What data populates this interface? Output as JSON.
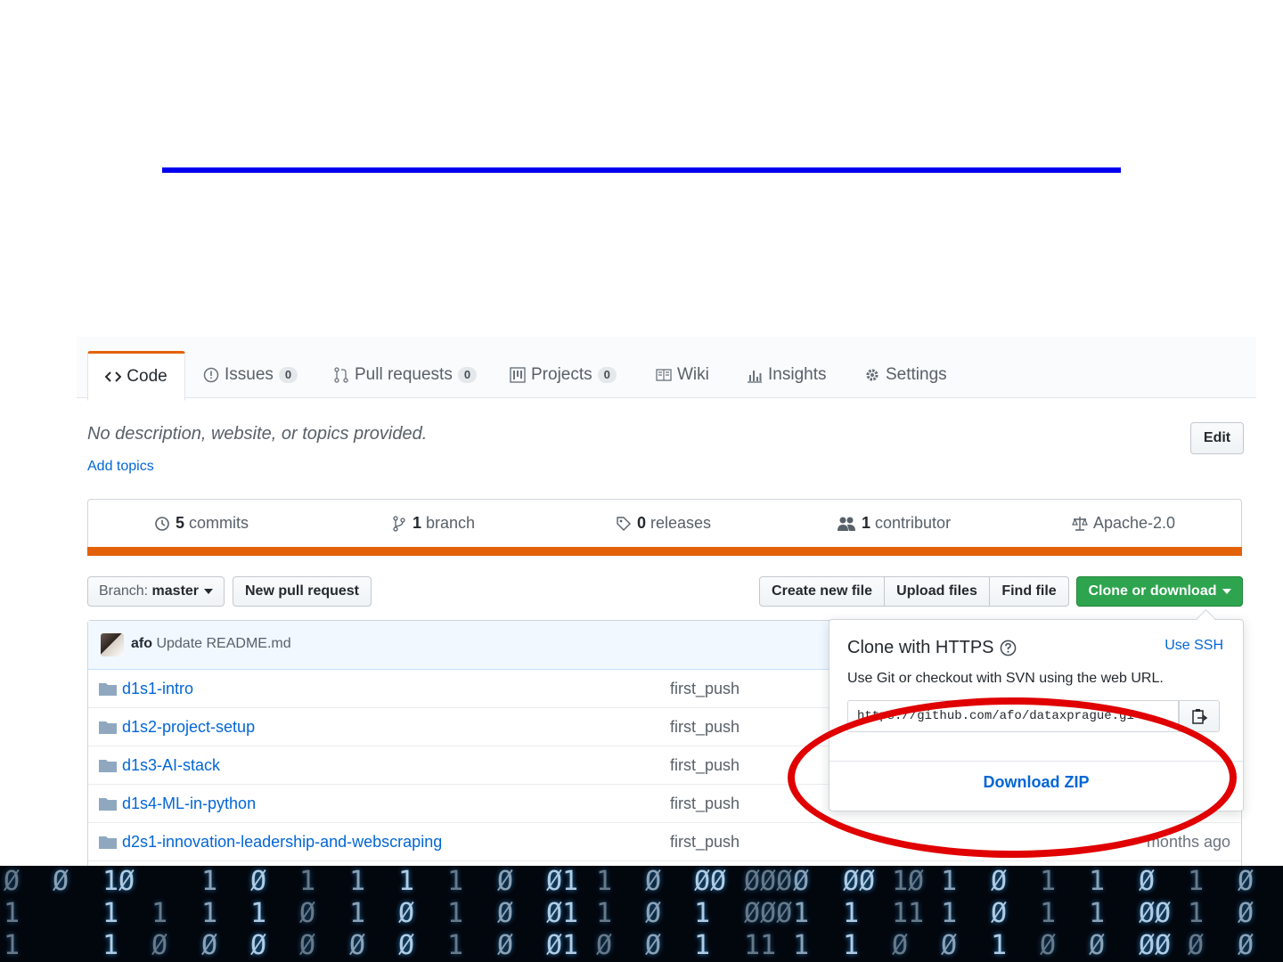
{
  "tabs": [
    {
      "label": "Code",
      "count": null
    },
    {
      "label": "Issues",
      "count": "0"
    },
    {
      "label": "Pull requests",
      "count": "0"
    },
    {
      "label": "Projects",
      "count": "0"
    },
    {
      "label": "Wiki",
      "count": null
    },
    {
      "label": "Insights",
      "count": null
    },
    {
      "label": "Settings",
      "count": null
    }
  ],
  "repo": {
    "description": "No description, website, or topics provided.",
    "add_topics": "Add topics",
    "edit_label": "Edit"
  },
  "summary": {
    "commits_count": "5",
    "commits_label": "commits",
    "branch_count": "1",
    "branch_label": "branch",
    "releases_count": "0",
    "releases_label": "releases",
    "contributor_count": "1",
    "contributor_label": "contributor",
    "license": "Apache-2.0",
    "accent_color": "#e36209"
  },
  "toolbar": {
    "branch_prefix": "Branch:",
    "branch_name": "master",
    "new_pull_request": "New pull request",
    "create_new_file": "Create new file",
    "upload_files": "Upload files",
    "find_file": "Find file",
    "clone_or_download": "Clone or download"
  },
  "latest_commit": {
    "author": "afo",
    "message": "Update README.md"
  },
  "files": [
    {
      "name": "d1s1-intro",
      "message": "first_push",
      "age": ""
    },
    {
      "name": "d1s2-project-setup",
      "message": "first_push",
      "age": ""
    },
    {
      "name": "d1s3-AI-stack",
      "message": "first_push",
      "age": ""
    },
    {
      "name": "d1s4-ML-in-python",
      "message": "first_push",
      "age": ""
    },
    {
      "name": "d2s1-innovation-leadership-and-webscraping",
      "message": "first_push",
      "age": "months ago"
    }
  ],
  "clone_popover": {
    "title": "Clone with HTTPS",
    "use_ssh": "Use SSH",
    "subtitle": "Use Git or checkout with SVN using the web URL.",
    "url": "https://github.com/afo/dataxprague.gi",
    "download_zip": "Download ZIP"
  },
  "matrix": [
    "Ø\n1\n1",
    "Ø\n",
    "1Ø\n1\n1",
    "\n1\nØ",
    "1\n1\nØ",
    "Ø\n1\nØ",
    "1\nØ\nØ",
    "1\n1\nØ",
    "1\nØ\nØ",
    "1\n1\n1",
    "Ø\nØ\nØ",
    "Ø1\nØ1\nØ1",
    "1\n1\nØ",
    "Ø\nØ\nØ",
    "ØØ\n1\n1",
    "ØØØ\nØØØ\n11",
    "Ø\n1\n1",
    "ØØ\n1\n1",
    "1Ø\n11\nØ",
    "1\n1\nØ",
    "Ø\nØ\n1",
    "1\n1\nØ",
    "1\n1\nØ",
    "Ø\nØØ\nØØ",
    "1\n1\nØ",
    "Ø\nØ\nØ"
  ],
  "colors": {
    "link": "#0366d6",
    "clone_button": "#2ea44f",
    "highlight_circle": "#e00000",
    "slide_rule": "#0000ee"
  }
}
